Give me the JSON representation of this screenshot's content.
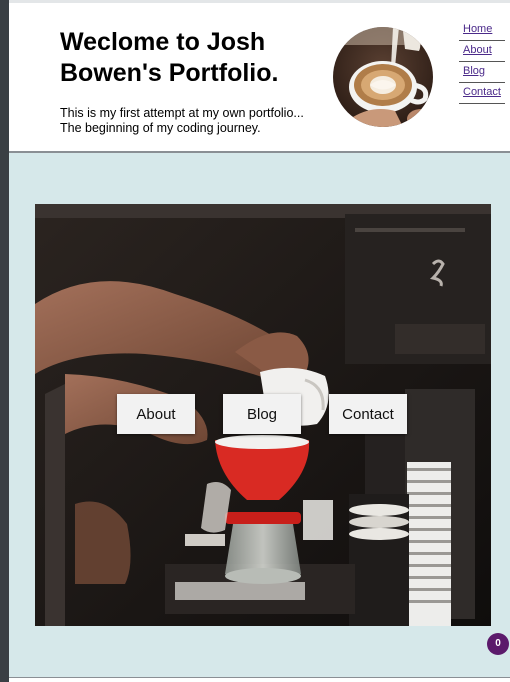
{
  "header": {
    "title": "Weclome to Josh Bowen's Portfolio.",
    "tagline_line1": "This is my first attempt at my own portfolio...",
    "tagline_line2": "The beginning of my coding journey."
  },
  "nav": {
    "items": [
      "Home",
      "About",
      "Blog",
      "Contact"
    ]
  },
  "hero": {
    "buttons": [
      "About",
      "Blog",
      "Contact"
    ]
  },
  "badge": {
    "count": "0"
  },
  "colors": {
    "page_background": "#d6e8ea",
    "link": "#4b2a8a",
    "badge": "#5b1a6b"
  },
  "icons": [
    "latte-art-image",
    "coffee-pour-over-photo"
  ]
}
